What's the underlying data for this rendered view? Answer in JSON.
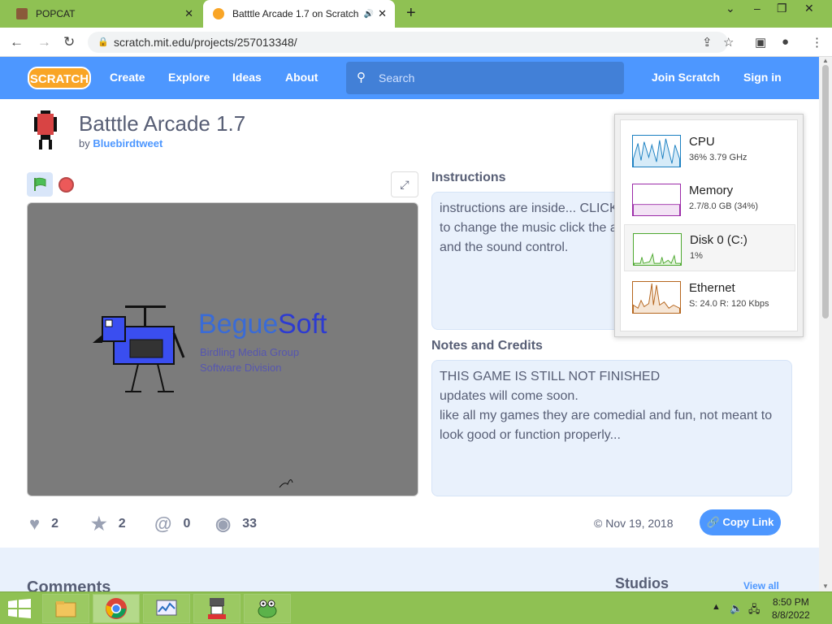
{
  "browser": {
    "tabs": [
      {
        "title": "POPCAT",
        "close": "✕"
      },
      {
        "title": "Batttle Arcade 1.7 on Scratch",
        "close": "✕",
        "audio": "🔊"
      }
    ],
    "new_tab": "+",
    "url": "scratch.mit.edu/projects/257013348/"
  },
  "nav": {
    "logo": "SCRATCH",
    "links": [
      "Create",
      "Explore",
      "Ideas",
      "About"
    ],
    "search_placeholder": "Search",
    "join": "Join Scratch",
    "signin": "Sign in"
  },
  "project": {
    "title": "Batttle Arcade 1.7",
    "by_prefix": "by",
    "author": "Bluebirdtweet"
  },
  "stage": {
    "brand_a": "Begue",
    "brand_b": "Soft",
    "sub1": "Birdling Media Group",
    "sub2": "Software Division"
  },
  "instructions": {
    "heading": "Instructions",
    "lines": [
      "instructions are inside... CLICK",
      "to change the music click the a",
      "and the sound control."
    ]
  },
  "notes": {
    "heading": "Notes and Credits",
    "lines": [
      "THIS GAME IS STILL NOT FINISHED",
      "updates will come soon.",
      "like all my games they are comedial and fun, not meant to",
      "look good or function properly..."
    ]
  },
  "stats": {
    "loves": "2",
    "favorites": "2",
    "remixes": "0",
    "views": "33"
  },
  "date": "© Nov 19, 2018",
  "copy_link": "Copy Link",
  "comments_heading": "Comments",
  "studios_heading": "Studios",
  "view_all": "View all",
  "task_manager": [
    {
      "name": "CPU",
      "value": "36%  3.79 GHz",
      "color": "#1a7fc1"
    },
    {
      "name": "Memory",
      "value": "2.7/8.0 GB (34%)",
      "color": "#9b2aa8"
    },
    {
      "name": "Disk 0 (C:)",
      "value": "1%",
      "color": "#4da82f"
    },
    {
      "name": "Ethernet",
      "value": "S: 24.0  R: 120 Kbps",
      "color": "#b5651d"
    }
  ],
  "clock": {
    "time": "8:50 PM",
    "date": "8/8/2022"
  }
}
